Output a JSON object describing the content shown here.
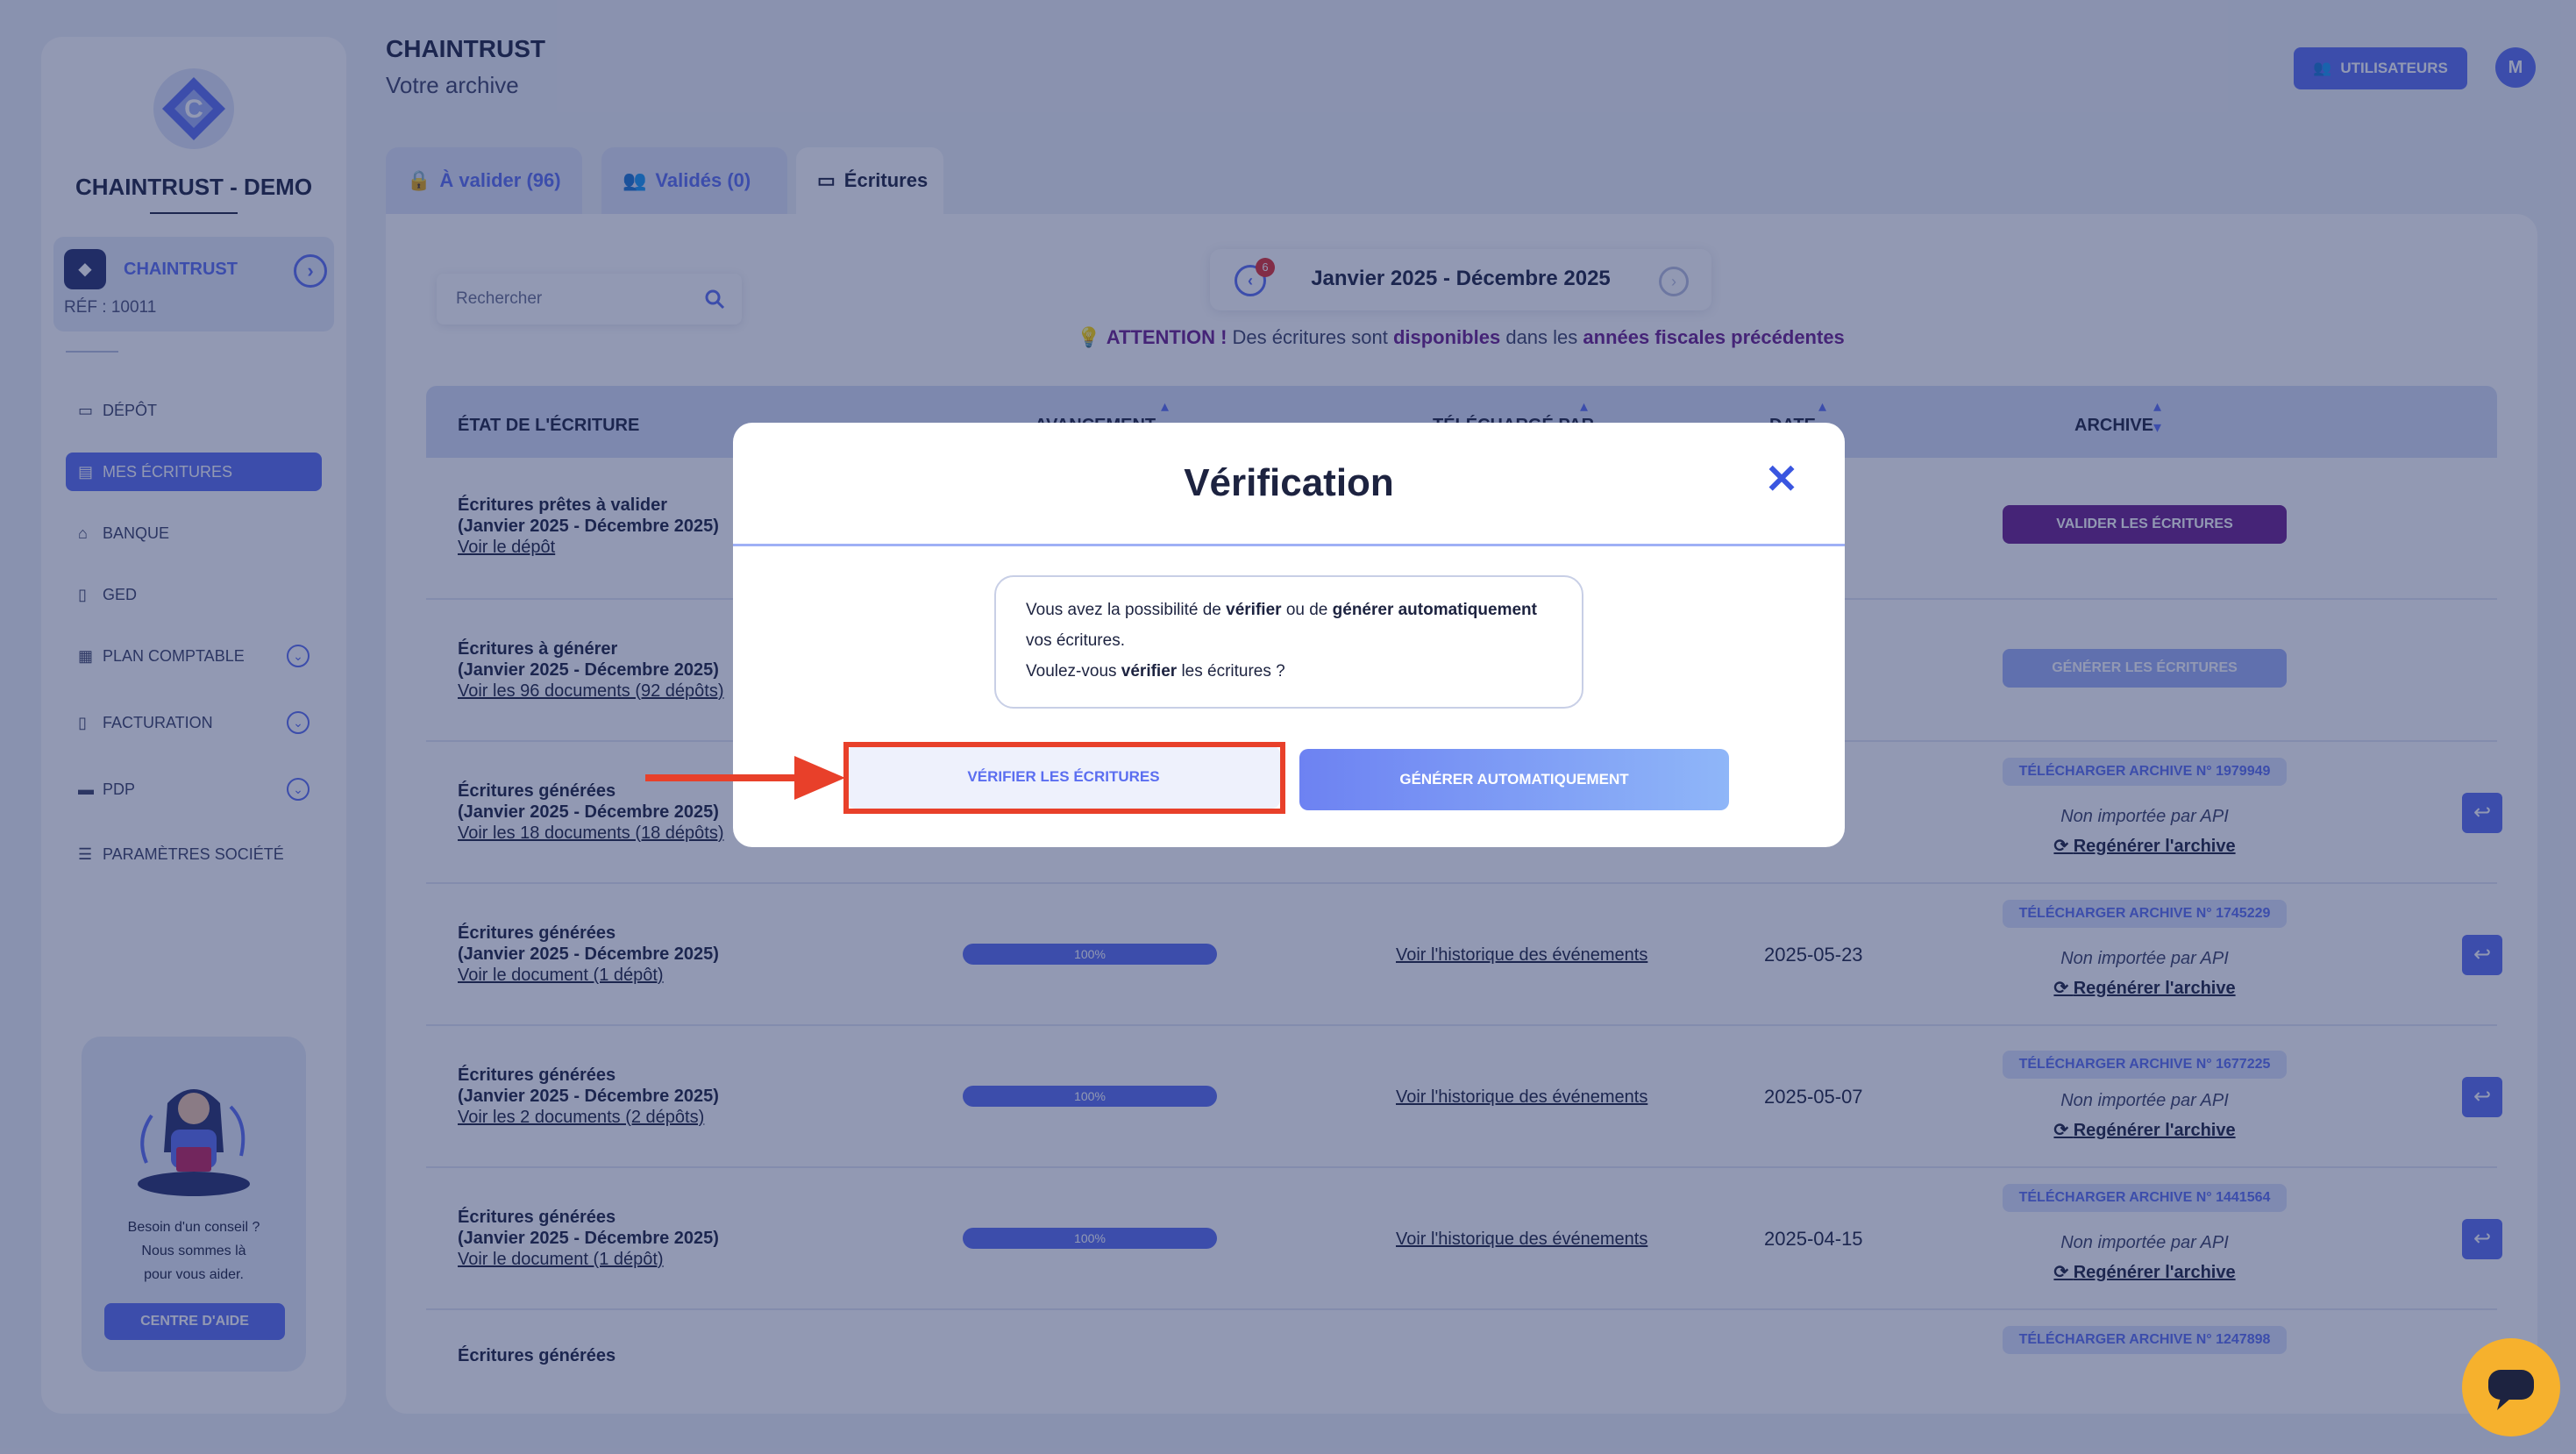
{
  "sidebar": {
    "company": "CHAINTRUST - DEMO",
    "client": {
      "name": "CHAINTRUST",
      "ref": "RÉF : 10011"
    },
    "nav": [
      {
        "label": "Dépôt",
        "icon": "folder-icon"
      },
      {
        "label": "Mes écritures",
        "icon": "entries-icon",
        "active": true
      },
      {
        "label": "Banque",
        "icon": "bank-icon"
      },
      {
        "label": "GED",
        "icon": "document-icon"
      },
      {
        "label": "Plan comptable",
        "icon": "ledger-icon",
        "expandable": true
      },
      {
        "label": "Facturation",
        "icon": "invoice-icon",
        "expandable": true
      },
      {
        "label": "PDP",
        "icon": "card-icon",
        "expandable": true
      },
      {
        "label": "Paramètres société",
        "icon": "sliders-icon"
      }
    ],
    "help": {
      "line1": "Besoin d'un conseil ?",
      "line2": "Nous sommes là",
      "line3": "pour vous aider.",
      "button": "CENTRE D'AIDE"
    }
  },
  "header": {
    "title": "CHAINTRUST",
    "subtitle": "Votre archive",
    "users_button": "UTILISATEURS",
    "avatar_initial": "M"
  },
  "tabs": [
    {
      "label": "À valider (96)",
      "icon": "lock-icon"
    },
    {
      "label": "Validés (0)",
      "icon": "users-icon"
    },
    {
      "label": "Écritures",
      "icon": "folder-icon",
      "active": true
    }
  ],
  "toolbar": {
    "search_placeholder": "Rechercher",
    "period": "Janvier 2025 - Décembre 2025",
    "period_badge": "6",
    "attention": {
      "p1": "ATTENTION !",
      "p2": "Des écritures sont",
      "p3": "disponibles",
      "p4": "dans les",
      "p5": "années fiscales précédentes"
    }
  },
  "table": {
    "headers": [
      "État de l'écriture",
      "Avancement",
      "Téléchargé par",
      "Date",
      "Archive"
    ],
    "rows": [
      {
        "title": "Écritures prêtes à valider",
        "period": "(Janvier 2025 - Décembre 2025)",
        "link": "Voir le dépôt",
        "archive_action": "VALIDER LES ÉCRITURES"
      },
      {
        "title": "Écritures à générer",
        "period": "(Janvier 2025 - Décembre 2025)",
        "link": "Voir les 96 documents (92 dépôts)",
        "archive_action": "GÉNÉRER LES ÉCRITURES"
      },
      {
        "title": "Écritures générées",
        "period": "(Janvier 2025 - Décembre 2025)",
        "link": "Voir les 18 documents (18 dépôts)",
        "download": "TÉLÉCHARGER ARCHIVE N° 1979949",
        "api": "Non importée par API",
        "regen": "Regénérer l'archive"
      },
      {
        "title": "Écritures générées",
        "period": "(Janvier 2025 - Décembre 2025)",
        "link": "Voir le document (1 dépôt)",
        "progress": "100%",
        "history": "Voir l'historique des événements",
        "date": "2025-05-23",
        "download": "TÉLÉCHARGER ARCHIVE N° 1745229",
        "api": "Non importée par API",
        "regen": "Regénérer l'archive"
      },
      {
        "title": "Écritures générées",
        "period": "(Janvier 2025 - Décembre 2025)",
        "link": "Voir les 2 documents (2 dépôts)",
        "progress": "100%",
        "history": "Voir l'historique des événements",
        "date": "2025-05-07",
        "download": "TÉLÉCHARGER ARCHIVE N° 1677225",
        "api": "Non importée par API",
        "regen": "Regénérer l'archive"
      },
      {
        "title": "Écritures générées",
        "period": "(Janvier 2025 - Décembre 2025)",
        "link": "Voir le document (1 dépôt)",
        "progress": "100%",
        "history": "Voir l'historique des événements",
        "date": "2025-04-15",
        "download": "TÉLÉCHARGER ARCHIVE N° 1441564",
        "api": "Non importée par API",
        "regen": "Regénérer l'archive"
      },
      {
        "title": "Écritures générées",
        "download": "TÉLÉCHARGER ARCHIVE N° 1247898"
      }
    ]
  },
  "modal": {
    "title": "Vérification",
    "msg": {
      "t1": "Vous avez la possibilité de",
      "t2": "vérifier",
      "t3": "ou de",
      "t4": "générer automatiquement",
      "t5": "vos écritures.",
      "t6": "Voulez-vous",
      "t7": "vérifier",
      "t8": "les écritures ?"
    },
    "verify_button": "VÉRIFIER LES ÉCRITURES",
    "generate_button": "GÉNÉRER AUTOMATIQUEMENT"
  },
  "colors": {
    "accent": "#5b6ef0",
    "purple": "#6b1f8c",
    "highlight": "#e8402a",
    "chat": "#f6b12d"
  }
}
